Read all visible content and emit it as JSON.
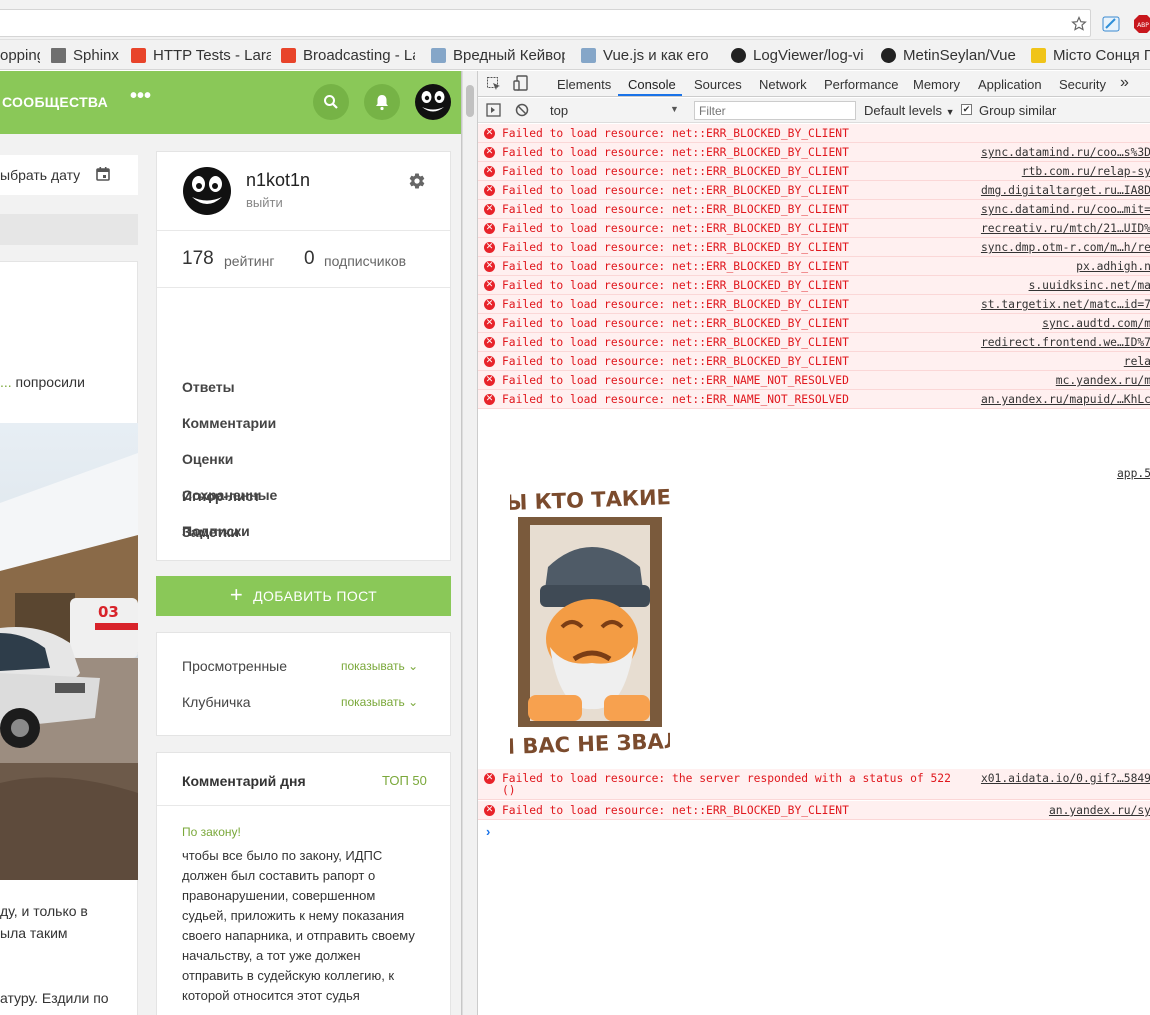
{
  "browser": {
    "bookmarks": [
      {
        "label": "opping",
        "color": "#ffffff"
      },
      {
        "label": "Sphinx",
        "color": "#6f6f6f"
      },
      {
        "label": "HTTP Tests - Lara",
        "color": "#e8442a"
      },
      {
        "label": "Broadcasting - La",
        "color": "#e8442a"
      },
      {
        "label": "Вредный Кейвор",
        "color": "#85a6c8"
      },
      {
        "label": "Vue.js и как его",
        "color": "#85a6c8"
      },
      {
        "label": "LogViewer/log-vi",
        "color": "#222222"
      },
      {
        "label": "MetinSeylan/Vue",
        "color": "#222222"
      },
      {
        "label": "Місто Сонця Г",
        "color": "#f0c419"
      }
    ]
  },
  "site": {
    "nav_communities": "СООБЩЕСТВА",
    "nav_more": "•••",
    "brand_color": "#8ac858",
    "date_picker_label": "ыбрать дату",
    "post": {
      "link_text": "...",
      "after_link": " попросили",
      "lines": [
        "ду, и только в",
        "ыла таким",
        "атуру. Ездили по"
      ]
    },
    "profile": {
      "username": "n1kot1n",
      "logout": "выйти",
      "rating_value": "178",
      "rating_label": "рейтинг",
      "subscribers_value": "0",
      "subscribers_label": "подписчиков",
      "menu": [
        "Ответы",
        "Комментарии",
        "Оценки",
        "Сохраненные",
        "Подписки",
        "Игнор-лист",
        "Заметки"
      ]
    },
    "add_post": "ДОБАВИТЬ ПОСТ",
    "filters": [
      {
        "label": "Просмотренные",
        "value": "показывать"
      },
      {
        "label": "Клубничка",
        "value": "показывать"
      }
    ],
    "comment_of_day": {
      "title": "Комментарий дня",
      "top_link": "ТОП 50",
      "post_title": "По закону!",
      "lines": [
        "чтобы все было по закону, ИДПС",
        "должен был составить рапорт о",
        "правонарушении, совершенном",
        "судьей, приложить к нему показания",
        "своего напарника, и отправить своему",
        "начальству, а тот уже должен",
        "отправить в судейскую коллегию, к",
        "которой относится этот судья"
      ]
    }
  },
  "devtools": {
    "tabs": [
      "Elements",
      "Console",
      "Sources",
      "Network",
      "Performance",
      "Memory",
      "Application",
      "Security"
    ],
    "more_tabs": "»",
    "context": "top",
    "filter_placeholder": "Filter",
    "levels": "Default levels",
    "group_similar": "Group similar",
    "logs": [
      {
        "msg": "Failed to load resource: net::ERR_BLOCKED_BY_CLIENT",
        "src": ""
      },
      {
        "msg": "Failed to load resource: net::ERR_BLOCKED_BY_CLIENT",
        "src": "sync.datamind.ru/coo…s%3D"
      },
      {
        "msg": "Failed to load resource: net::ERR_BLOCKED_BY_CLIENT",
        "src": "rtb.com.ru/relap-sy"
      },
      {
        "msg": "Failed to load resource: net::ERR_BLOCKED_BY_CLIENT",
        "src": "dmg.digitaltarget.ru…IA8D"
      },
      {
        "msg": "Failed to load resource: net::ERR_BLOCKED_BY_CLIENT",
        "src": "sync.datamind.ru/coo…mit="
      },
      {
        "msg": "Failed to load resource: net::ERR_BLOCKED_BY_CLIENT",
        "src": "recreativ.ru/mtch/21…UID%"
      },
      {
        "msg": "Failed to load resource: net::ERR_BLOCKED_BY_CLIENT",
        "src": "sync.dmp.otm-r.com/m…h/re"
      },
      {
        "msg": "Failed to load resource: net::ERR_BLOCKED_BY_CLIENT",
        "src": "px.adhigh.n"
      },
      {
        "msg": "Failed to load resource: net::ERR_BLOCKED_BY_CLIENT",
        "src": "s.uuidksinc.net/ma"
      },
      {
        "msg": "Failed to load resource: net::ERR_BLOCKED_BY_CLIENT",
        "src": "st.targetix.net/matc…id=7"
      },
      {
        "msg": "Failed to load resource: net::ERR_BLOCKED_BY_CLIENT",
        "src": "sync.audtd.com/m"
      },
      {
        "msg": "Failed to load resource: net::ERR_BLOCKED_BY_CLIENT",
        "src": "redirect.frontend.we…ID%7"
      },
      {
        "msg": "Failed to load resource: net::ERR_BLOCKED_BY_CLIENT",
        "src": "rela"
      },
      {
        "msg": "Failed to load resource: net::ERR_NAME_NOT_RESOLVED",
        "src": "mc.yandex.ru/m"
      },
      {
        "msg": "Failed to load resource: net::ERR_NAME_NOT_RESOLVED",
        "src": "an.yandex.ru/mapuid/…KhLc"
      }
    ],
    "app_source": "app.5",
    "sticker_top": "ВЫ КТО ТАКИЕ ?",
    "sticker_bottom": "Я ВАС НЕ ЗВАЛ",
    "logs_after": [
      {
        "msg": "Failed to load resource: the server responded with a status of 522",
        "msg2": "()",
        "src": "x01.aidata.io/0.gif?…5849"
      },
      {
        "msg": "Failed to load resource: net::ERR_BLOCKED_BY_CLIENT",
        "src": "an.yandex.ru/sy"
      }
    ],
    "prompt": "›"
  }
}
